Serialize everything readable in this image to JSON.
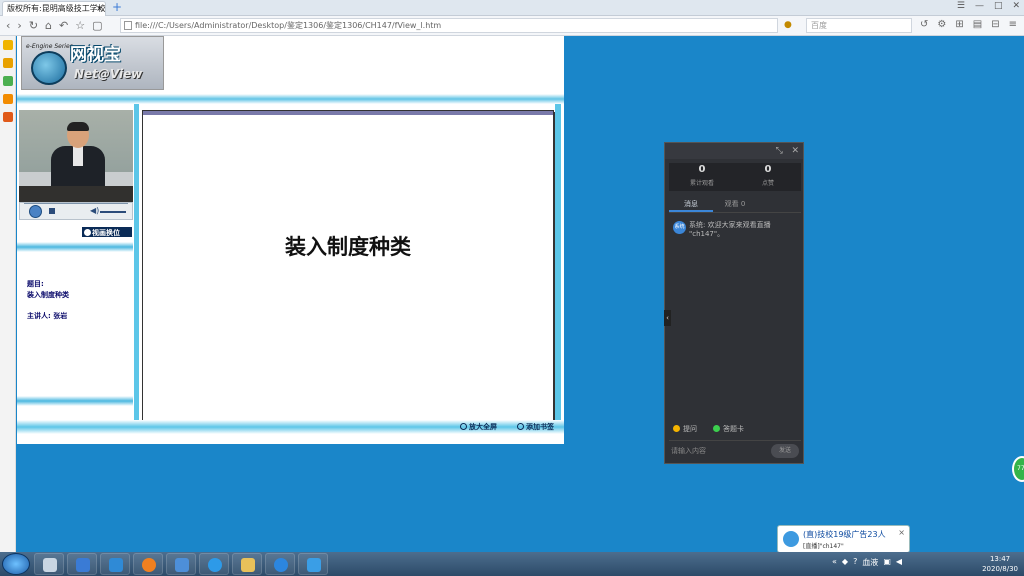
{
  "browser": {
    "tab_title": "版权所有:昆明高级技工学校(C",
    "tab_close": "×",
    "new_tab": "+",
    "address": "file:///C:/Users/Administrator/Desktop/鉴定1306/鉴定1306/CH147/fView_l.htm",
    "search_placeholder": "百度",
    "win_controls": [
      "☰",
      "—",
      "□",
      "✕"
    ],
    "nav_icons": [
      "‹",
      "›",
      "↻",
      "⌂",
      "↶",
      "☆",
      "▢"
    ],
    "right_icons": [
      "↺",
      "⚙",
      "⊞",
      "▤",
      "⊟",
      "≡"
    ]
  },
  "side_icons": [
    {
      "name": "star-icon",
      "color": "#f0b400"
    },
    {
      "name": "note-icon",
      "color": "#e8a100"
    },
    {
      "name": "chat-icon",
      "color": "#4caf50"
    },
    {
      "name": "rss-icon",
      "color": "#f28b00"
    },
    {
      "name": "history-icon",
      "color": "#e05a1a"
    }
  ],
  "logo": {
    "series": "e-Engine Series",
    "cn": "网视宝",
    "en": "Net@View"
  },
  "player": {
    "switch_label": "视画换位",
    "volume_icon": "◀)"
  },
  "course_info": {
    "title_label": "题目:",
    "title_value": "装入制度种类",
    "speaker_label": "主讲人:",
    "speaker_value": "张岩"
  },
  "slide": {
    "heading": "装入制度种类"
  },
  "footer": {
    "fullscreen": "放大全屏",
    "add_bookmark": "添加书签"
  },
  "chat": {
    "header_icons": [
      "⤡",
      "✕"
    ],
    "stats": [
      {
        "value": "0",
        "label": "累计观看"
      },
      {
        "value": "0",
        "label": "点赞"
      }
    ],
    "tabs": [
      "消息",
      "观看 0"
    ],
    "message_avatar": "系统",
    "message_text": "系统: 欢迎大家来观看直播 \"ch147\"。",
    "options": [
      {
        "label": "提问",
        "color": "#f5b400"
      },
      {
        "label": "答题卡",
        "color": "#3ccf4e"
      }
    ],
    "input_placeholder": "请输入内容",
    "send_label": "发送",
    "collapse_icon": "‹"
  },
  "green_bubble": "77k",
  "notification": {
    "line1": "(直)技校19级广告23人",
    "line2": "[直播]\"ch147\"",
    "close": "×"
  },
  "taskbar": {
    "apps": [
      {
        "name": "notepad-app",
        "color": "#c9d6e3"
      },
      {
        "name": "calculator-app",
        "color": "#3a7bd5"
      },
      {
        "name": "monitor-app",
        "color": "#2f8ad6"
      },
      {
        "name": "firefox-app",
        "color": "#f08020"
      },
      {
        "name": "feather-app",
        "color": "#4d8fd9"
      },
      {
        "name": "qq-app",
        "color": "#2d9ae8"
      },
      {
        "name": "explorer-app",
        "color": "#e8c15a"
      },
      {
        "name": "live-app",
        "color": "#2c86df"
      },
      {
        "name": "camera-app",
        "color": "#3a9ee6"
      }
    ],
    "tray_text": "血液",
    "time": "13:47",
    "date": "2020/8/30"
  }
}
